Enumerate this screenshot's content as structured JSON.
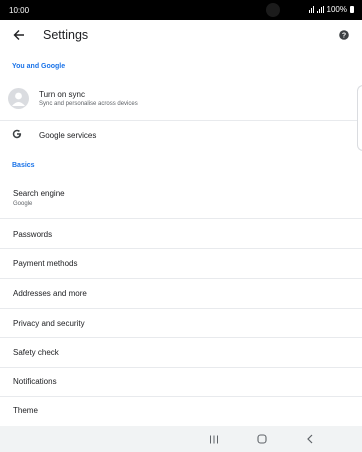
{
  "status_bar": {
    "time": "10:00",
    "battery": "100%"
  },
  "header": {
    "title": "Settings"
  },
  "sections": {
    "you_and_google": "You and Google",
    "basics": "Basics"
  },
  "sync": {
    "title": "Turn on sync",
    "subtitle": "Sync and personalise across devices"
  },
  "google_services": {
    "label": "Google services"
  },
  "search_engine": {
    "label": "Search engine",
    "value": "Google"
  },
  "items": {
    "passwords": "Passwords",
    "payment_methods": "Payment methods",
    "addresses": "Addresses and more",
    "privacy": "Privacy and security",
    "safety_check": "Safety check",
    "notifications": "Notifications",
    "theme": "Theme"
  },
  "colors": {
    "accent": "#1a73e8",
    "status_bar": "#000000",
    "nav_bar": "#f1f3f4"
  },
  "icons": [
    "back-arrow-icon",
    "help-icon",
    "avatar-icon",
    "google-g-icon",
    "recent-apps-icon",
    "home-icon",
    "back-nav-icon"
  ]
}
